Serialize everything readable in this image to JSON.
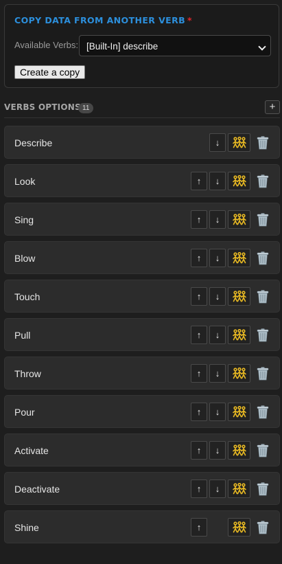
{
  "copy_panel": {
    "title": "COPY DATA FROM ANOTHER VERB",
    "required_mark": "*",
    "available_label": "Available Verbs:",
    "selected_verb": "[Built-In] describe",
    "copy_button_label": "Create a copy"
  },
  "options_section": {
    "title": "VERBS OPTIONS",
    "count": "11",
    "add_label": "+"
  },
  "controls": {
    "up_label": "↑",
    "down_label": "↓",
    "actors_icon": "people-icon",
    "delete_icon": "trash-icon"
  },
  "verbs": [
    {
      "label": "Describe",
      "can_move_up": false,
      "can_move_down": true
    },
    {
      "label": "Look",
      "can_move_up": true,
      "can_move_down": true
    },
    {
      "label": "Sing",
      "can_move_up": true,
      "can_move_down": true
    },
    {
      "label": "Blow",
      "can_move_up": true,
      "can_move_down": true
    },
    {
      "label": "Touch",
      "can_move_up": true,
      "can_move_down": true
    },
    {
      "label": "Pull",
      "can_move_up": true,
      "can_move_down": true
    },
    {
      "label": "Throw",
      "can_move_up": true,
      "can_move_down": true
    },
    {
      "label": "Pour",
      "can_move_up": true,
      "can_move_down": true
    },
    {
      "label": "Activate",
      "can_move_up": true,
      "can_move_down": true
    },
    {
      "label": "Deactivate",
      "can_move_up": true,
      "can_move_down": true
    },
    {
      "label": "Shine",
      "can_move_up": true,
      "can_move_down": false
    }
  ],
  "colors": {
    "accent": "#2c8fdc",
    "required": "#e0262b",
    "icon_yellow": "#e8b923"
  }
}
